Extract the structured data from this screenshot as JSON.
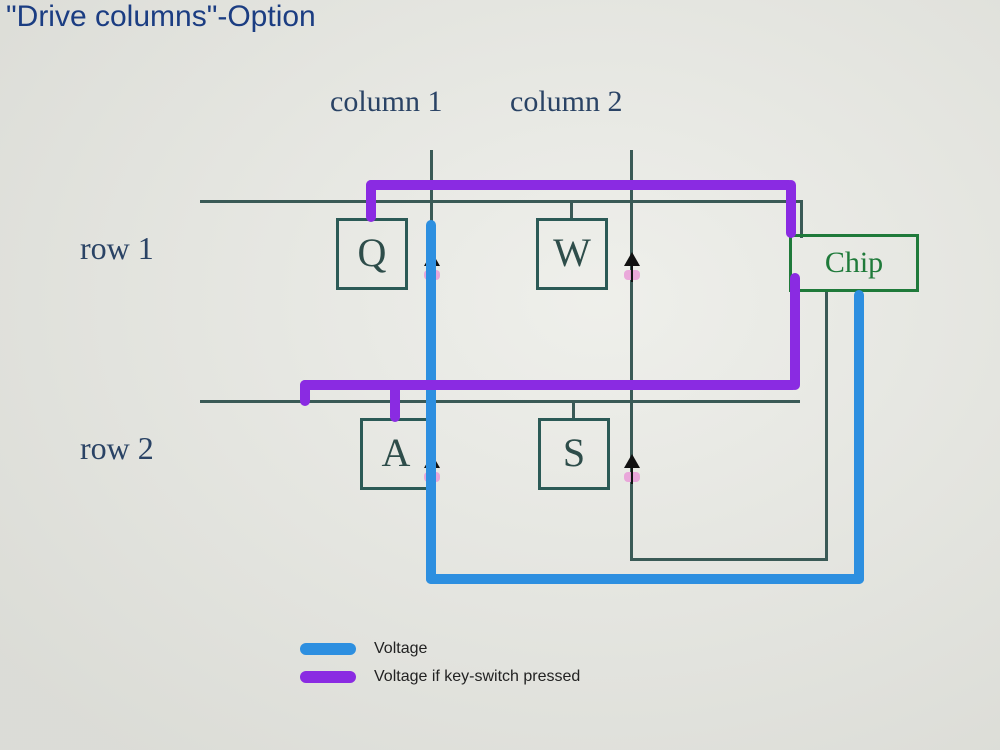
{
  "title": "\"Drive columns\"-Option",
  "labels": {
    "col1": "column 1",
    "col2": "column 2",
    "row1": "row 1",
    "row2": "row 2"
  },
  "keys": {
    "Q": "Q",
    "W": "W",
    "A": "A",
    "S": "S"
  },
  "chip": "Chip",
  "legend": {
    "voltage": "Voltage",
    "voltage_pressed": "Voltage if key-switch pressed"
  },
  "colors": {
    "voltage": "#2d8fe0",
    "voltage_pressed": "#8a2be2",
    "pen": "#3a5a56",
    "chip_border": "#1f7a3a",
    "title": "#1b3d82"
  },
  "diagram": {
    "type": "keyboard-matrix",
    "rows": [
      "row 1",
      "row 2"
    ],
    "columns": [
      "column 1",
      "column 2"
    ],
    "grid": [
      [
        "Q",
        "W"
      ],
      [
        "A",
        "S"
      ]
    ],
    "driven_line": "column 1",
    "sensed_lines": [
      "row 1",
      "row 2"
    ],
    "controller": "Chip",
    "diode_direction": "column_to_row"
  }
}
